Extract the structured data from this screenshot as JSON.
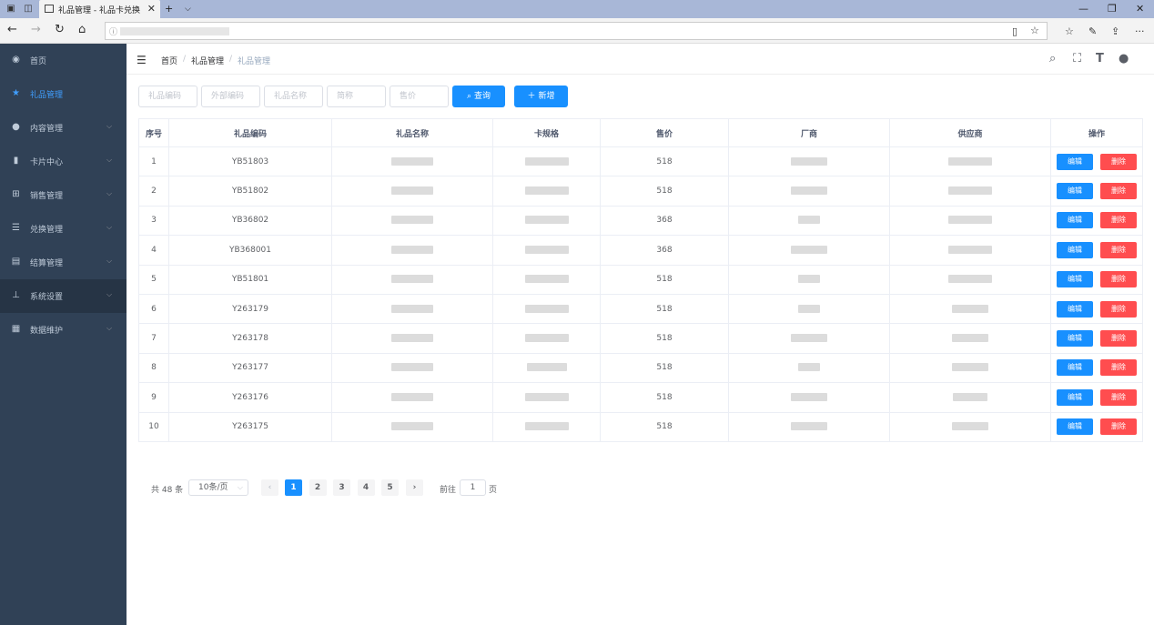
{
  "browser": {
    "tab_title": "礼品管理 - 礼品卡兑换",
    "new_tab": "+",
    "menu_dots": "···"
  },
  "sidebar": {
    "items": [
      {
        "label": "首页",
        "icon": "dashboard-icon",
        "glyph": "◉",
        "arrow": false
      },
      {
        "label": "礼品管理",
        "icon": "star-icon",
        "glyph": "★",
        "arrow": false,
        "active": true
      },
      {
        "label": "内容管理",
        "icon": "circle-icon",
        "glyph": "●",
        "arrow": true
      },
      {
        "label": "卡片中心",
        "icon": "card-icon",
        "glyph": "▮",
        "arrow": true
      },
      {
        "label": "销售管理",
        "icon": "cart-icon",
        "glyph": "⊞",
        "arrow": true
      },
      {
        "label": "兑换管理",
        "icon": "list-icon",
        "glyph": "☰",
        "arrow": true
      },
      {
        "label": "结算管理",
        "icon": "document-icon",
        "glyph": "▤",
        "arrow": true
      },
      {
        "label": "系统设置",
        "icon": "tree-icon",
        "glyph": "⊥",
        "arrow": true
      },
      {
        "label": "数据维护",
        "icon": "grid-icon",
        "glyph": "▦",
        "arrow": true
      }
    ]
  },
  "breadcrumb": {
    "home": "首页",
    "parent": "礼品管理",
    "current": "礼品管理",
    "sep": "/"
  },
  "filters": {
    "gift_code": "礼品编码",
    "external_code": "外部编码",
    "gift_name": "礼品名称",
    "short_name": "简称",
    "price": "售价",
    "search_label": "查询",
    "add_label": "新增"
  },
  "table": {
    "headers": [
      "序号",
      "礼品编码",
      "礼品名称",
      "卡规格",
      "售价",
      "厂商",
      "供应商",
      "操作"
    ],
    "edit_label": "编辑",
    "delete_label": "删除",
    "rows": [
      {
        "no": "1",
        "code": "YB51803",
        "price": "518"
      },
      {
        "no": "2",
        "code": "YB51802",
        "price": "518"
      },
      {
        "no": "3",
        "code": "YB36802",
        "price": "368"
      },
      {
        "no": "4",
        "code": "YB368001",
        "price": "368"
      },
      {
        "no": "5",
        "code": "YB51801",
        "price": "518"
      },
      {
        "no": "6",
        "code": "Y263179",
        "price": "518"
      },
      {
        "no": "7",
        "code": "Y263178",
        "price": "518"
      },
      {
        "no": "8",
        "code": "Y263177",
        "price": "518"
      },
      {
        "no": "9",
        "code": "Y263176",
        "price": "518"
      },
      {
        "no": "10",
        "code": "Y263175",
        "price": "518"
      }
    ]
  },
  "pagination": {
    "total": "共 48 条",
    "page_size": "10条/页",
    "pages": [
      "1",
      "2",
      "3",
      "4",
      "5"
    ],
    "current": "1",
    "goto_prefix": "前往",
    "goto_value": "1",
    "goto_suffix": "页"
  },
  "colors": {
    "sidebar_bg": "#304156",
    "primary": "#1890ff",
    "danger": "#ff4d4f"
  }
}
